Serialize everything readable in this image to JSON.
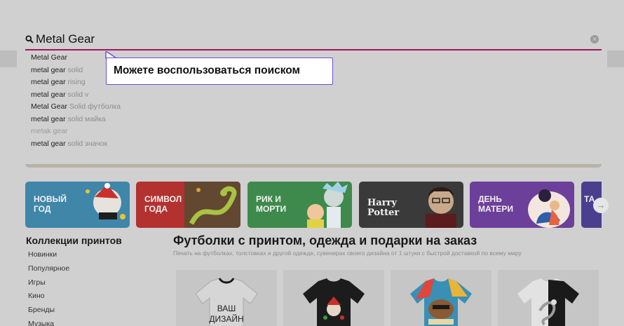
{
  "search": {
    "value": "Metal Gear",
    "suggestions": [
      {
        "match": "Metal Gear",
        "rest": ""
      },
      {
        "match": "metal gear",
        "rest": " solid"
      },
      {
        "match": "metal gear",
        "rest": " rising"
      },
      {
        "match": "metal gear",
        "rest": " solid v"
      },
      {
        "match": "Metal Gear",
        "rest": " Solid футболка"
      },
      {
        "match": "metal gear",
        "rest": " solid майка"
      },
      {
        "match": "metak gear",
        "rest": ""
      },
      {
        "match": "metal gear",
        "rest": " solid значок"
      }
    ]
  },
  "tooltip": {
    "text": "Можете воспользоваться поиском"
  },
  "collections": [
    {
      "label": "НОВЫЙ ГОД",
      "color": "#3f86a8",
      "icon": "santa-art-icon"
    },
    {
      "label": "СИМВОЛ ГОДА",
      "color": "#b3312f",
      "icon": "snake-art-icon"
    },
    {
      "label": "РИК И МОРТИ",
      "color": "#3e8a4c",
      "icon": "rick-morty-art-icon"
    },
    {
      "label": "Harry Potter",
      "color": "#3a3a3a",
      "icon": "harry-potter-art-icon"
    },
    {
      "label": "ДЕНЬ МАТЕРИ",
      "color": "#6c3f9a",
      "icon": "mother-art-icon"
    },
    {
      "label": "ТА",
      "color": "#4a3f8f",
      "icon": "partial-card-icon"
    }
  ],
  "sidebar": {
    "title": "Коллекции принтов",
    "items": [
      "Новинки",
      "Популярное",
      "Игры",
      "Кино",
      "Бренды",
      "Музыка"
    ]
  },
  "main": {
    "title": "Футболки с принтом, одежда и подарки на заказ",
    "subtitle": "Печать на футболках, толстовках и другой одежде, сувенирах своего дизайна от 1 штуки с быстрой доставкой по всему миру"
  },
  "products": [
    {
      "print_line1": "ВАШ",
      "print_line2": "ДИЗАЙН",
      "tee_color": "#d6d6d6"
    },
    {
      "tee_color": "#1c1c1c"
    },
    {
      "tee_color": "#c9a030"
    },
    {
      "tee_color": "#e2e2e2"
    }
  ],
  "colors": {
    "accent": "#a0185a",
    "tooltip_border": "#6b4fd8",
    "overlay_bg": "#d0d0d0"
  }
}
